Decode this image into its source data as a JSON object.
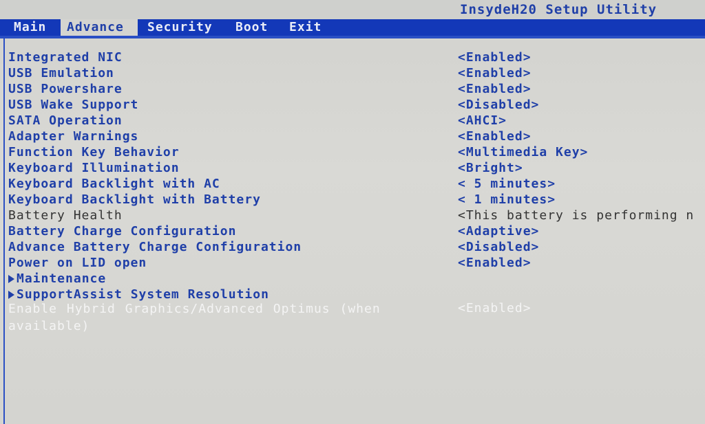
{
  "title": "InsydeH20 Setup Utility",
  "menu": {
    "tabs": [
      {
        "label": "Main"
      },
      {
        "label": "Advance"
      },
      {
        "label": "Security"
      },
      {
        "label": "Boot"
      },
      {
        "label": "Exit"
      }
    ],
    "active": "Advance"
  },
  "settings": [
    {
      "label": "Integrated NIC",
      "value": "<Enabled>"
    },
    {
      "label": "USB Emulation",
      "value": "<Enabled>"
    },
    {
      "label": "USB Powershare",
      "value": "<Enabled>"
    },
    {
      "label": "USB Wake Support",
      "value": "<Disabled>"
    },
    {
      "label": "SATA Operation",
      "value": "<AHCI>"
    },
    {
      "label": "Adapter Warnings",
      "value": "<Enabled>"
    },
    {
      "label": "Function Key Behavior",
      "value": "<Multimedia Key>"
    },
    {
      "label": "Keyboard Illumination",
      "value": "<Bright>"
    },
    {
      "label": "Keyboard Backlight with AC",
      "value": "< 5 minutes>"
    },
    {
      "label": "Keyboard Backlight with Battery",
      "value": "< 1 minutes>"
    },
    {
      "label": "Battery Health",
      "value": "<This battery is performing n"
    },
    {
      "label": "Battery Charge Configuration",
      "value": "<Adaptive>"
    },
    {
      "label": "Advance Battery Charge Configuration",
      "value": "<Disabled>"
    },
    {
      "label": "Power on LID open",
      "value": "<Enabled>"
    },
    {
      "label": "Maintenance"
    },
    {
      "label": "SupportAssist System Resolution"
    },
    {
      "label": "Enable Hybrid Graphics/Advanced Optimus (when available)",
      "value": "<Enabled>"
    }
  ],
  "colors": {
    "accent": "#1338b8",
    "text": "#1f3fa8",
    "background": "#d6d6d2",
    "selected_text": "#f4f4f4",
    "readonly_text": "#333333"
  },
  "icons": {
    "submenu": "right-triangle-icon"
  }
}
